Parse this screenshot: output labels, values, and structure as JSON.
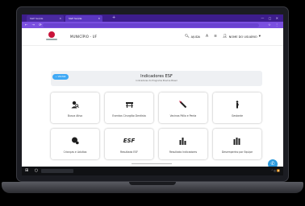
{
  "browser": {
    "tabs": [
      {
        "label": "SGP Saúde"
      },
      {
        "label": "SGP Saúde"
      }
    ],
    "new_tab_glyph": "+",
    "window_controls": "— ▢ ✕",
    "nav_glyphs": "← → ⟳",
    "address_icons": "☆ ⋮"
  },
  "header": {
    "city": "MUNICÍPIO - UF",
    "help_label": "AJUDA",
    "user_label": "NOME DO USUÁRIO"
  },
  "main": {
    "back_label": "← VOLTAR",
    "title": "Indicadores ESF",
    "subtitle": "Indicadores do Programa Previne Brasil",
    "cards": [
      {
        "label": "Busca Ativa",
        "icon": "user-search-icon",
        "glyph": "🔍"
      },
      {
        "label": "Eventos Cirurgião Dentista",
        "icon": "dental-chair-icon",
        "glyph": "⊓"
      },
      {
        "label": "Vacinas Pólio e Penta",
        "icon": "syringe-icon",
        "glyph": "✎"
      },
      {
        "label": "Gestante",
        "icon": "pregnant-icon",
        "glyph": "♀"
      },
      {
        "label": "Crianças e Adultos",
        "icon": "people-icon",
        "glyph": "●"
      },
      {
        "label": "Resultado ESF",
        "icon": "esf-icon",
        "glyph": "ESF"
      },
      {
        "label": "Resultado Indicadores",
        "icon": "indicators-chart-icon",
        "glyph": "▆"
      },
      {
        "label": "Desempenho por Equipe",
        "icon": "team-chart-icon",
        "glyph": "▇"
      }
    ]
  },
  "fab_glyph": "✆",
  "taskbar": {
    "start_glyph": "⊞ ○",
    "tray": "⌃ ◫ 📶"
  },
  "colors": {
    "tabbar": "#3d1d8c",
    "addrbar": "#7a4fe0",
    "accent": "#3fa9f5",
    "logo": "#c9143a"
  }
}
